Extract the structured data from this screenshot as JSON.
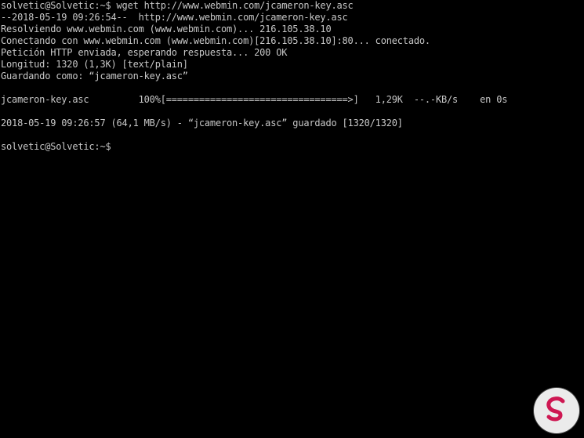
{
  "terminal": {
    "lines": [
      "solvetic@Solvetic:~$ wget http://www.webmin.com/jcameron-key.asc",
      "--2018-05-19 09:26:54--  http://www.webmin.com/jcameron-key.asc",
      "Resolviendo www.webmin.com (www.webmin.com)... 216.105.38.10",
      "Conectando con www.webmin.com (www.webmin.com)[216.105.38.10]:80... conectado.",
      "Petición HTTP enviada, esperando respuesta... 200 OK",
      "Longitud: 1320 (1,3K) [text/plain]",
      "Guardando como: “jcameron-key.asc”",
      "",
      "jcameron-key.asc         100%[=================================>]   1,29K  --.-KB/s    en 0s",
      "",
      "2018-05-19 09:26:57 (64,1 MB/s) - “jcameron-key.asc” guardado [1320/1320]",
      "",
      "solvetic@Solvetic:~$ "
    ]
  },
  "colors": {
    "background": "#000000",
    "text": "#c7c7c7",
    "logo_accent": "#e0195a"
  },
  "icons": {
    "watermark": "solvetic-s-logo-icon"
  }
}
